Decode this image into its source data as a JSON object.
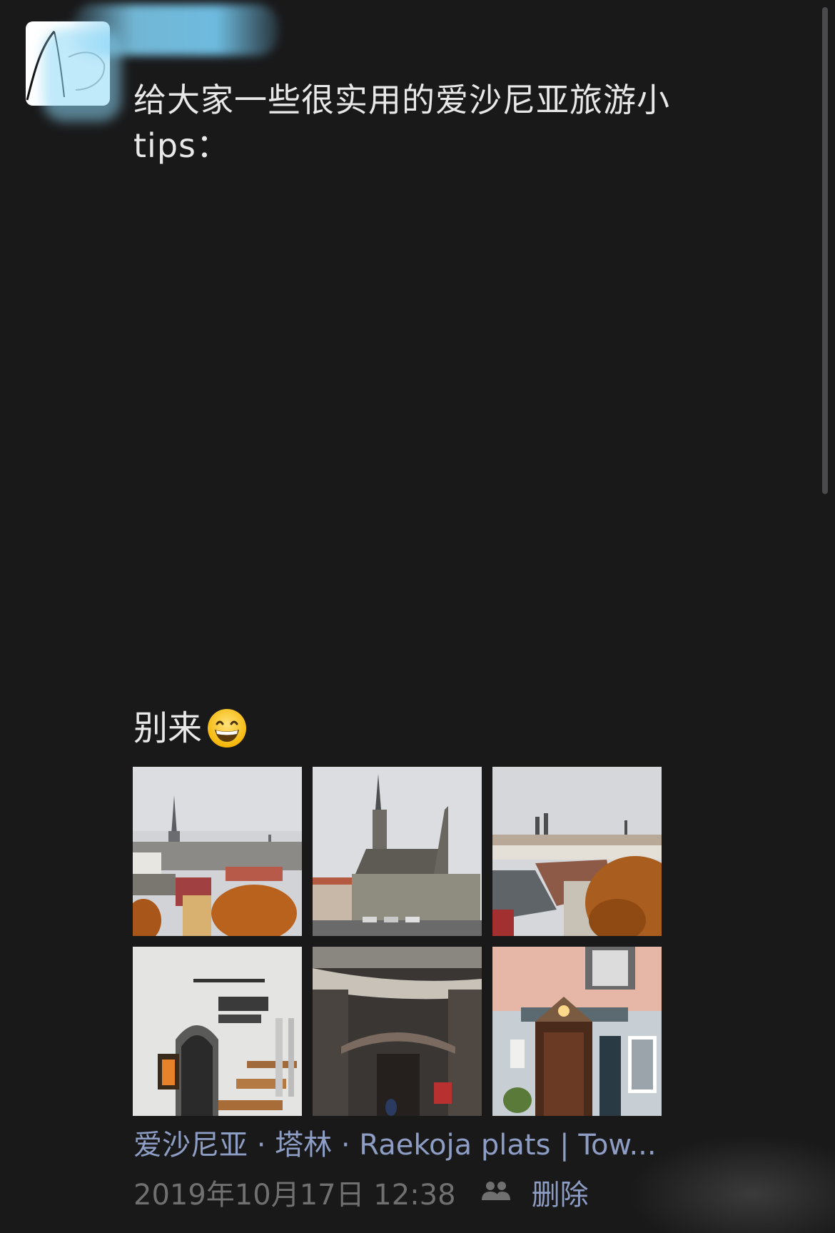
{
  "post": {
    "text_line1": "给大家一些很实用的爱沙尼亚旅游小",
    "text_line2": "tips：",
    "closing_text": "别来",
    "closing_emoji": "grinning-face-emoji",
    "photos": [
      {
        "name": "tallinn-old-town-spire-view"
      },
      {
        "name": "tallinn-town-hall"
      },
      {
        "name": "tallinn-rooftops-autumn"
      },
      {
        "name": "arcade-walkway-with-lantern"
      },
      {
        "name": "st-catherines-passage"
      },
      {
        "name": "restaurant-entrance"
      }
    ],
    "location": "爱沙尼亚 · 塔林 · Raekoja plats | Tow...",
    "timestamp": "2019年10月17日 12:38",
    "delete_label": "删除",
    "visibility_icon": "friends-icon"
  },
  "colors": {
    "background": "#19191a",
    "text": "#e8e8e8",
    "link": "#8e9dc4",
    "meta": "#707070"
  }
}
